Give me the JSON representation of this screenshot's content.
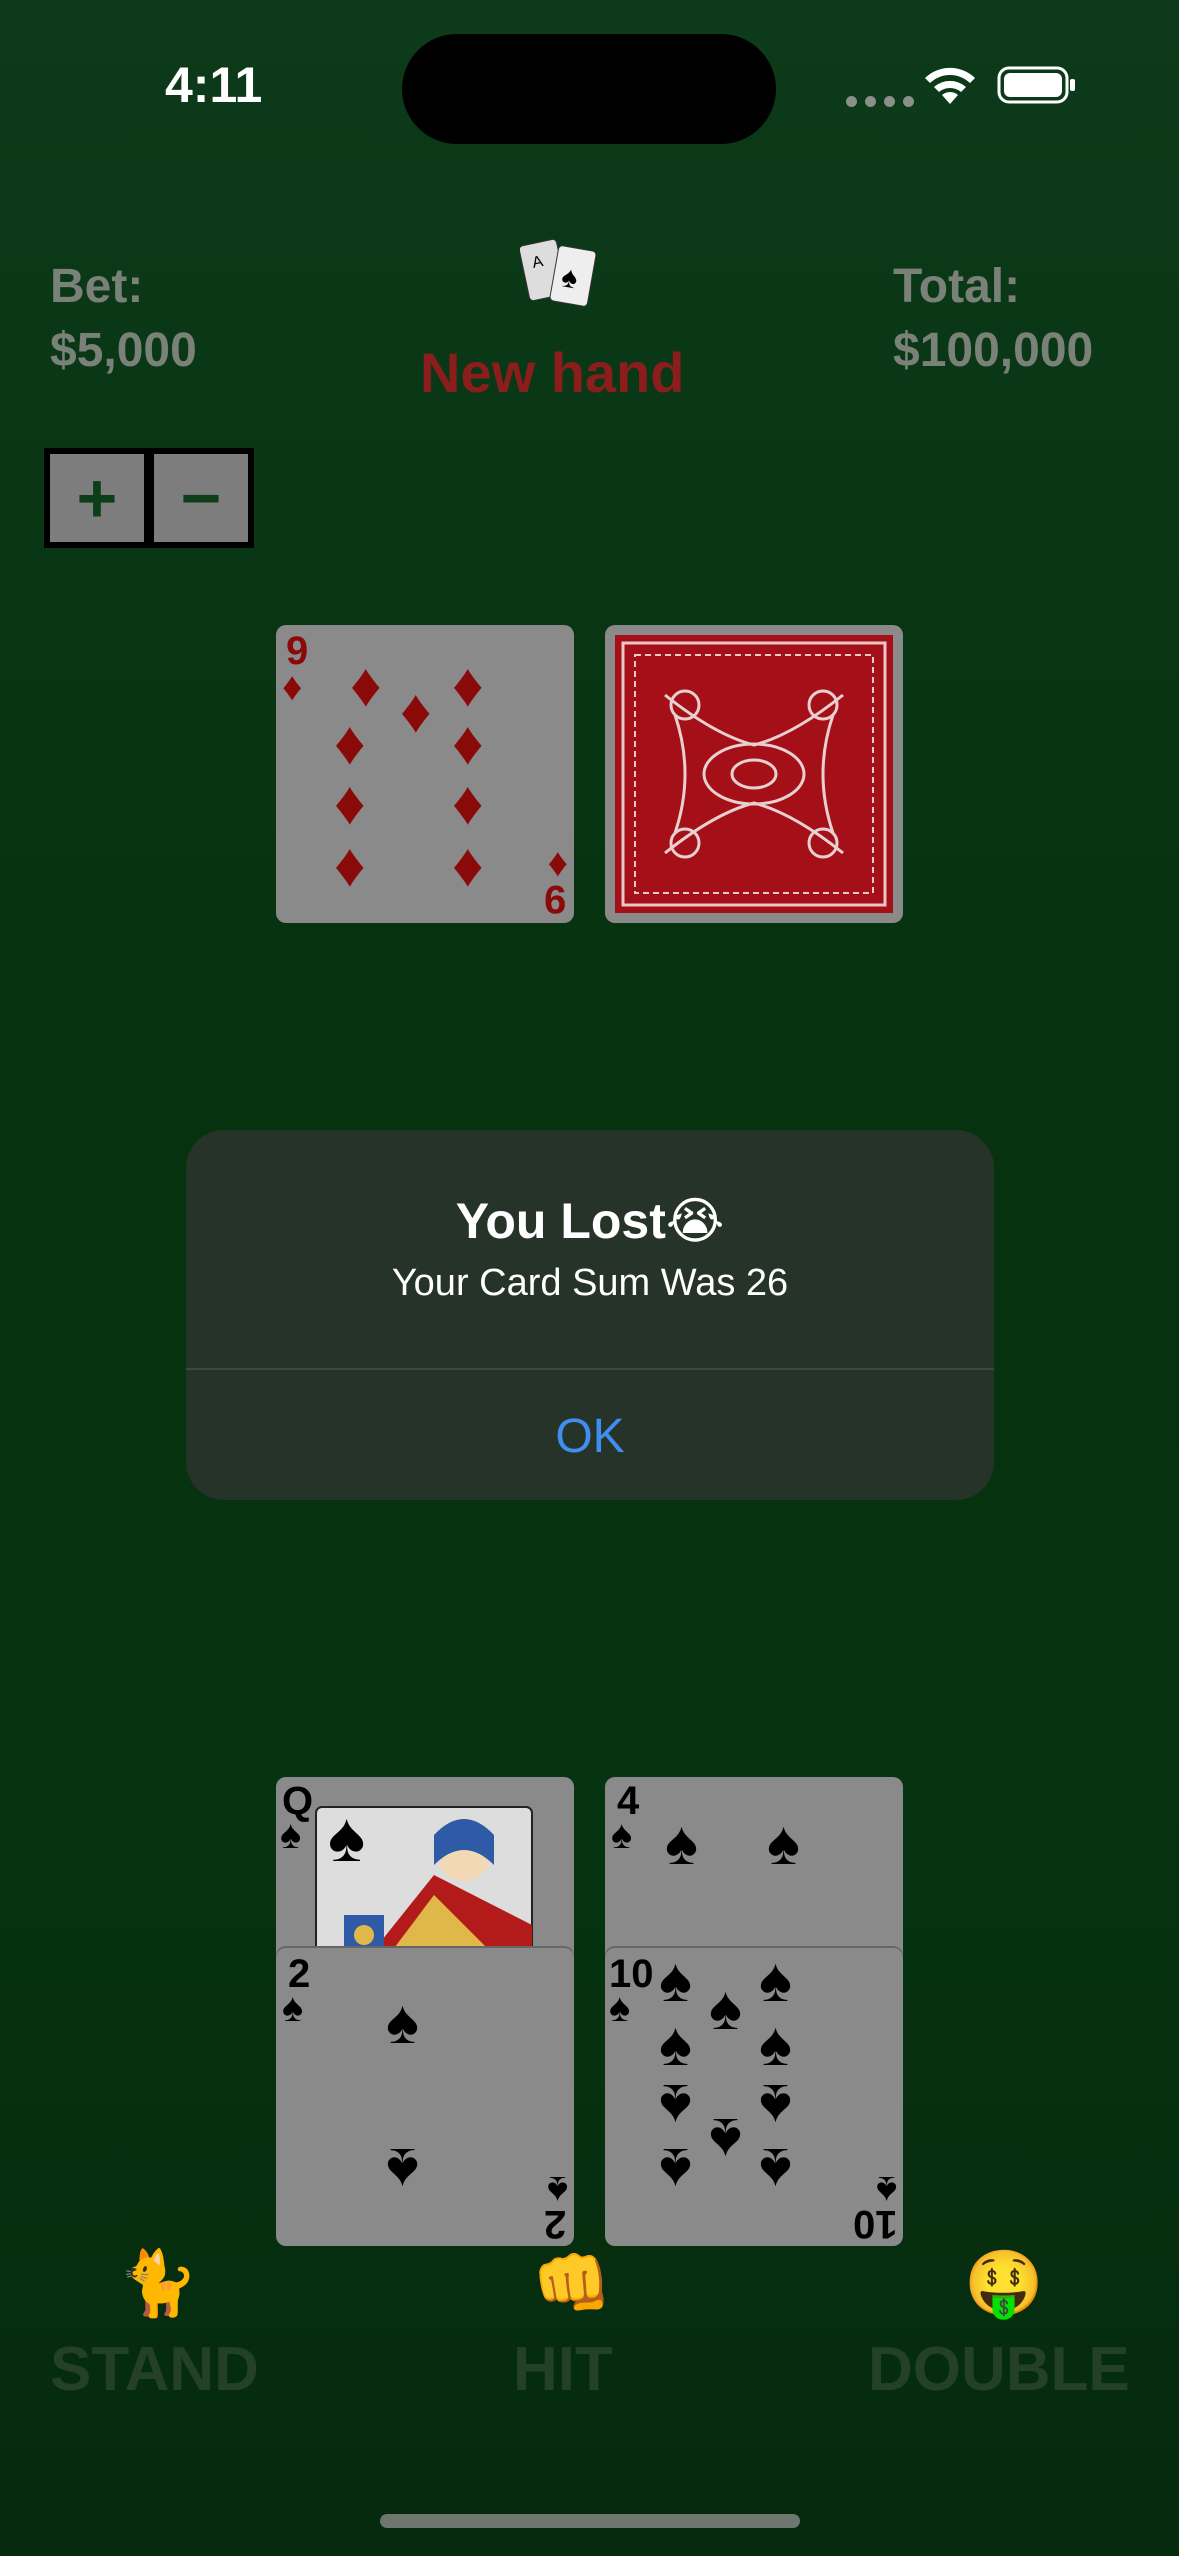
{
  "status_bar": {
    "time": "4:11"
  },
  "header": {
    "bet_label": "Bet:",
    "bet_value": "$5,000",
    "total_label": "Total:",
    "total_value": "$100,000",
    "new_hand_label": "New hand"
  },
  "stepper": {
    "plus": "+",
    "minus": "−"
  },
  "dealer_cards": [
    {
      "rank": "9",
      "suit": "♦",
      "face": "up"
    },
    {
      "face": "down"
    }
  ],
  "player_cards": [
    {
      "rank": "Q",
      "suit": "♠"
    },
    {
      "rank": "4",
      "suit": "♠"
    },
    {
      "rank": "2",
      "suit": "♠"
    },
    {
      "rank": "10",
      "suit": "♠"
    }
  ],
  "alert": {
    "title": "You Lost😭",
    "message": "Your Card Sum Was 26",
    "ok_label": "OK"
  },
  "actions": [
    {
      "emoji": "🐈",
      "label": "STAND"
    },
    {
      "emoji": "👊",
      "label": "HIT"
    },
    {
      "emoji": "🤑",
      "label": "DOUBLE"
    }
  ],
  "colors": {
    "table_green": "#07320f",
    "new_hand_red": "#8b1d1d",
    "alert_bg": "#263329",
    "ok_blue": "#3f8ef0"
  }
}
